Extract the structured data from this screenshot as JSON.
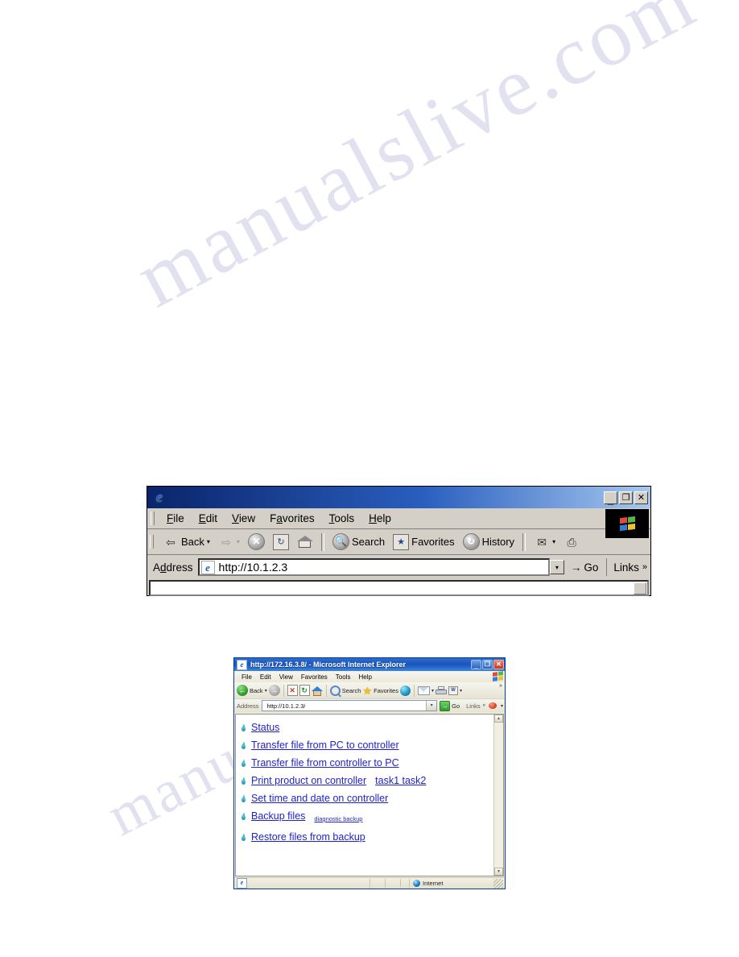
{
  "page": {
    "watermark_line1": "manualslive.com",
    "watermark_line2": "manualslib"
  },
  "classic_window": {
    "title": "",
    "ie_logo_glyph": "e",
    "window_buttons": [
      {
        "name": "minimize",
        "glyph": "_"
      },
      {
        "name": "maximize",
        "glyph": "❐"
      },
      {
        "name": "close",
        "glyph": "✕"
      }
    ],
    "menu": [
      {
        "label": "File",
        "accel": "F"
      },
      {
        "label": "Edit",
        "accel": "E"
      },
      {
        "label": "View",
        "accel": "V"
      },
      {
        "label": "Favorites",
        "accel": "a"
      },
      {
        "label": "Tools",
        "accel": "T"
      },
      {
        "label": "Help",
        "accel": "H"
      }
    ],
    "toolbar": {
      "back_label": "Back",
      "back_glyph": "⇦",
      "forward_glyph": "⇨",
      "dropdown_glyph": "▾",
      "stop_glyph": "✕",
      "refresh_glyph": "↻",
      "home_name": "Home",
      "search_label": "Search",
      "favorites_label": "Favorites",
      "history_label": "History",
      "mail_glyph": "✉",
      "print_glyph": "⎙"
    },
    "address": {
      "label": "Address",
      "accel": "d",
      "value": "http://10.1.2.3",
      "dropdown_glyph": "▾",
      "go_label": "Go",
      "go_glyph": "→",
      "links_label": "Links",
      "links_chevron": "»"
    }
  },
  "xp_window": {
    "title": "http://172.16.3.8/ - Microsoft Internet Explorer",
    "ie_logo_glyph": "e",
    "window_buttons": [
      {
        "name": "minimize",
        "glyph": "_"
      },
      {
        "name": "restore",
        "glyph": "❐"
      },
      {
        "name": "close",
        "glyph": "✕"
      }
    ],
    "menu": [
      {
        "label": "File"
      },
      {
        "label": "Edit"
      },
      {
        "label": "View"
      },
      {
        "label": "Favorites"
      },
      {
        "label": "Tools"
      },
      {
        "label": "Help"
      }
    ],
    "toolbar": {
      "back_label": "Back",
      "back_glyph": "←",
      "back_dropdown_glyph": "▾",
      "forward_glyph": "→",
      "stop_glyph": "✕",
      "refresh_glyph": "↻",
      "home_name": "Home",
      "search_label": "Search",
      "favorites_label": "Favorites",
      "media_name": "Media",
      "mail_glyph": "✉",
      "mail_dropdown_glyph": "▾",
      "print_name": "Print",
      "edit_glyph": "W",
      "edit_dropdown_glyph": "▾",
      "overflow_chevron": "»"
    },
    "address": {
      "label": "Address",
      "value": "http://10.1.2.3/",
      "dropdown_glyph": "▾",
      "go_label": "Go",
      "go_glyph": "→",
      "links_label": "Links",
      "links_chevron": "»"
    },
    "page_links": [
      {
        "label": "Status",
        "extra": ""
      },
      {
        "label": "Transfer file from PC to controller",
        "extra": ""
      },
      {
        "label": "Transfer file from controller to PC",
        "extra": ""
      },
      {
        "label": "Print product on controller",
        "extra": "task1 task2"
      },
      {
        "label": "Set time and date on controller",
        "extra": ""
      },
      {
        "label": "Backup files",
        "extra": "diagnostic backup"
      },
      {
        "label": "Restore files from backup",
        "extra": ""
      }
    ],
    "scroll": {
      "up_glyph": "▲",
      "down_glyph": "▼"
    },
    "statusbar": {
      "zone_label": "Internet"
    }
  },
  "colors": {
    "link": "#2222cc",
    "classic_title_start": "#0a246a",
    "xp_title_start": "#2b6ed4",
    "drop_icon": "#1b8fa8"
  }
}
